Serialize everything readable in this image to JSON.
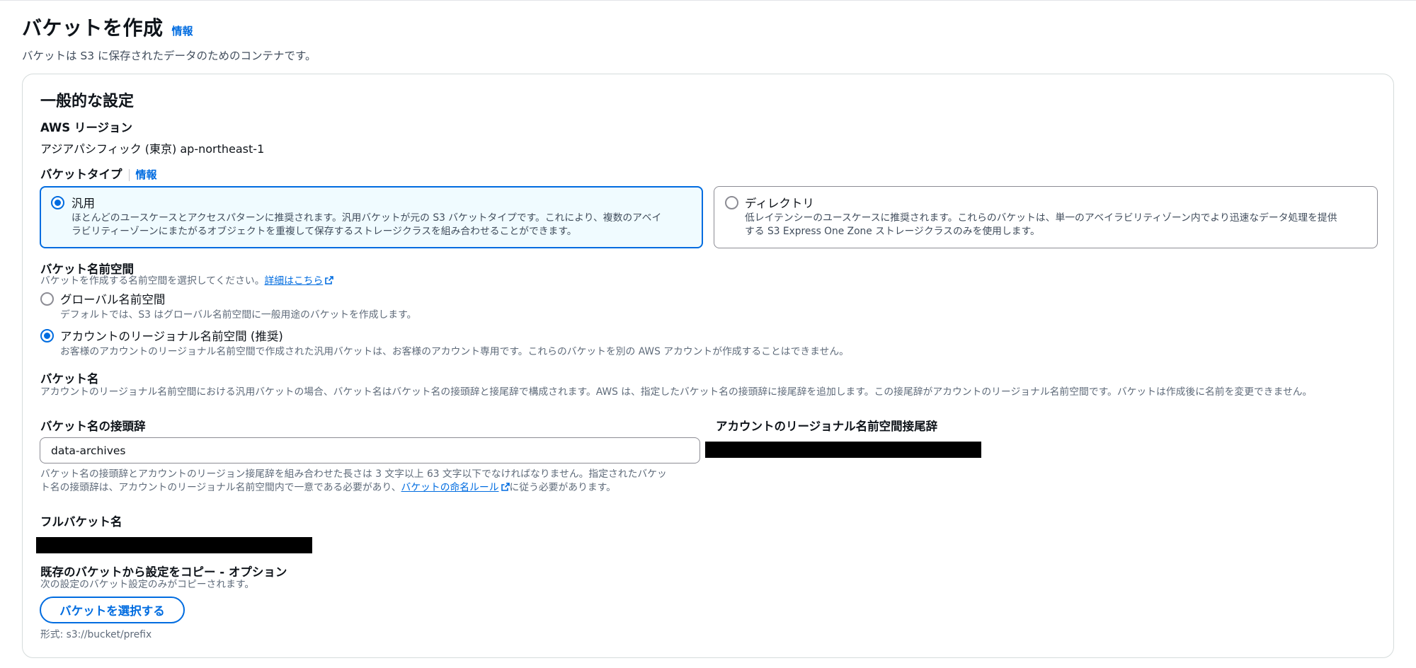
{
  "header": {
    "title": "バケットを作成",
    "info_label": "情報",
    "description": "バケットは S3 に保存されたデータのためのコンテナです。"
  },
  "general": {
    "section_title": "一般的な設定",
    "region": {
      "label": "AWS リージョン",
      "value": "アジアパシフィック (東京) ap-northeast-1"
    },
    "bucket_type": {
      "label": "バケットタイプ",
      "info_label": "情報",
      "options": [
        {
          "title": "汎用",
          "desc1": "ほとんどのユースケースとアクセスパターンに推奨されます。汎用バケットが元の S3 バケットタイプです。これにより、複数のアベイ",
          "desc2": "ラビリティーゾーンにまたがるオブジェクトを重複して保存するストレージクラスを組み合わせることができます。",
          "selected": true
        },
        {
          "title": "ディレクトリ",
          "desc1": "低レイテンシーのユースケースに推奨されます。これらのバケットは、単一のアベイラビリティゾーン内でより迅速なデータ処理を提供",
          "desc2": "する S3 Express One Zone ストレージクラスのみを使用します。",
          "selected": false
        }
      ]
    },
    "namespace": {
      "label": "バケット名前空間",
      "desc": "バケットを作成する名前空間を選択してください。",
      "learn_more": "詳細はこちら",
      "options": [
        {
          "title": "グローバル名前空間",
          "desc": "デフォルトでは、S3 はグローバル名前空間に一般用途のバケットを作成します。",
          "selected": false
        },
        {
          "title": "アカウントのリージョナル名前空間 (推奨)",
          "desc": "お客様のアカウントのリージョナル名前空間で作成された汎用バケットは、お客様のアカウント専用です。これらのバケットを別の AWS アカウントが作成することはできません。",
          "selected": true
        }
      ]
    },
    "bucket_name": {
      "label": "バケット名",
      "desc": "アカウントのリージョナル名前空間における汎用バケットの場合、バケット名はバケット名の接頭辞と接尾辞で構成されます。AWS は、指定したバケット名の接頭辞に接尾辞を追加します。この接尾辞がアカウントのリージョナル名前空間です。バケットは作成後に名前を変更できません。"
    },
    "prefix": {
      "label": "バケット名の接頭辞",
      "value": "data-archives",
      "help1": "バケット名の接頭辞とアカウントのリージョン接尾辞を組み合わせた長さは 3 文字以上 63 文字以下でなければなりません。指定されたバケッ",
      "help2_pre": "ト名の接頭辞は、アカウントのリージョナル名前空間内で一意である必要があり、",
      "help2_link": "バケットの命名ルール",
      "help2_post": "に従う必要があります。"
    },
    "suffix": {
      "label": "アカウントのリージョナル名前空間接尾辞"
    },
    "full_name": {
      "label": "フルバケット名"
    },
    "copy": {
      "label": "既存のバケットから設定をコピー - オプション",
      "desc": "次の設定のバケット設定のみがコピーされます。",
      "button": "バケットを選択する",
      "format": "形式: s3://bucket/prefix"
    }
  },
  "colors": {
    "accent": "#006ce0",
    "selected_bg": "#f0fbff",
    "muted_text": "#5f6b7a"
  }
}
